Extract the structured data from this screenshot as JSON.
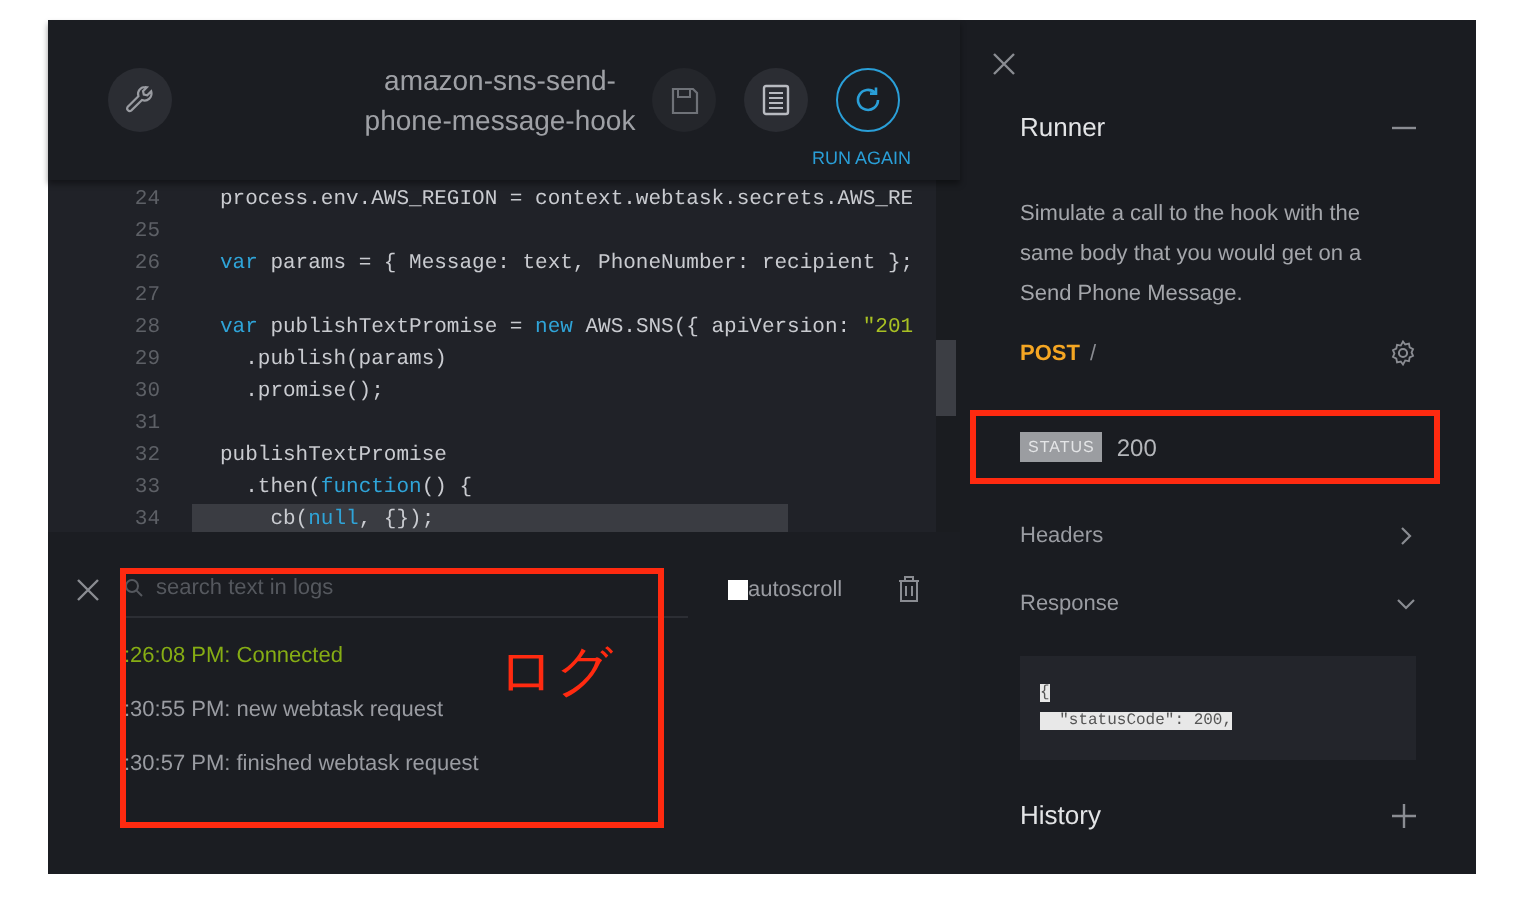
{
  "toolbar": {
    "title": "amazon-sns-send-phone-message-hook",
    "run_label": "RUN AGAIN"
  },
  "editor": {
    "lines": [
      {
        "number": "24",
        "highlighted": false,
        "tokens": [
          {
            "kind": "plain",
            "text": "process.env.AWS_REGION = context.webtask.secrets.AWS_RE"
          }
        ]
      },
      {
        "number": "25",
        "highlighted": false
      },
      {
        "number": "26",
        "highlighted": false,
        "tokens": [
          {
            "kind": "keyword",
            "text": "var"
          },
          {
            "kind": "plain",
            "text": " params = { Message: text, PhoneNumber: recipient };"
          }
        ]
      },
      {
        "number": "27",
        "highlighted": false
      },
      {
        "number": "28",
        "highlighted": false,
        "tokens": [
          {
            "kind": "keyword",
            "text": "var"
          },
          {
            "kind": "plain",
            "text": " publishTextPromise = "
          },
          {
            "kind": "keyword",
            "text": "new"
          },
          {
            "kind": "plain",
            "text": " AWS.SNS({ apiVersion: "
          },
          {
            "kind": "string",
            "text": "\"201"
          }
        ]
      },
      {
        "number": "29",
        "highlighted": false,
        "tokens": [
          {
            "kind": "plain",
            "text": "  .publish(params)"
          }
        ]
      },
      {
        "number": "30",
        "highlighted": false,
        "tokens": [
          {
            "kind": "plain",
            "text": "  .promise();"
          }
        ]
      },
      {
        "number": "31",
        "highlighted": false
      },
      {
        "number": "32",
        "highlighted": false,
        "tokens": [
          {
            "kind": "plain",
            "text": "publishTextPromise"
          }
        ]
      },
      {
        "number": "33",
        "highlighted": false,
        "tokens": [
          {
            "kind": "plain",
            "text": "  .then("
          },
          {
            "kind": "keyword",
            "text": "function"
          },
          {
            "kind": "plain",
            "text": "() {"
          }
        ]
      },
      {
        "number": "34",
        "highlighted": true,
        "tokens": [
          {
            "kind": "plain",
            "text": "    cb("
          },
          {
            "kind": "keyword",
            "text": "null"
          },
          {
            "kind": "plain",
            "text": ", {});"
          }
        ]
      }
    ]
  },
  "logs": {
    "search": {
      "placeholder": "search text in logs"
    },
    "autoscroll": {
      "label": "autoscroll",
      "checked": false
    },
    "entries": [
      {
        "kind": "success",
        "text": ":26:08 PM: Connected"
      },
      {
        "kind": "info",
        "text": ":30:55 PM: new webtask request"
      },
      {
        "kind": "info",
        "text": ":30:57 PM: finished webtask request"
      }
    ],
    "annotation": {
      "label": "ログ"
    }
  },
  "runner": {
    "title": "Runner",
    "expanded": true,
    "description": "Simulate a call to the hook with the same body that you would get on a Send Phone Message.",
    "method": "POST",
    "path": "/",
    "status": {
      "badge": "STATUS",
      "code": "200",
      "annotated": true
    },
    "sections": [
      {
        "label": "Headers",
        "expanded": false
      },
      {
        "label": "Response",
        "expanded": true
      }
    ],
    "response_lines": [
      "{",
      "  \"statusCode\": 200,"
    ],
    "history": {
      "title": "History"
    }
  }
}
